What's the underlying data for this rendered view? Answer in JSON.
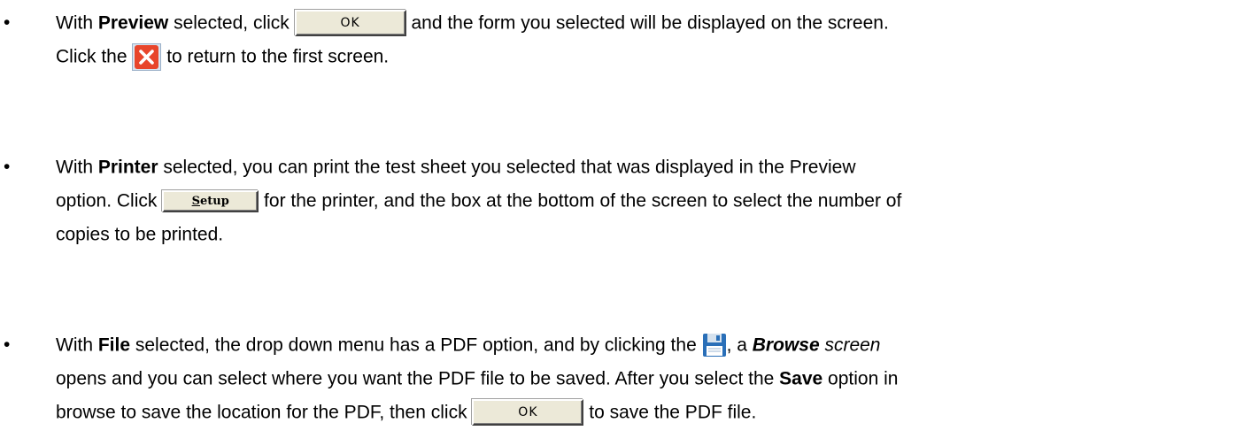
{
  "bullet_glyph": "•",
  "items": [
    {
      "line1": {
        "pre": "With ",
        "bold": "Preview",
        "mid": " selected, click ",
        "button": "OK",
        "post": " and the form you selected will be displayed on the screen."
      },
      "line2": {
        "pre": "Click the ",
        "icon": "close-icon",
        "post": " to return to the first screen."
      }
    },
    {
      "line1": {
        "pre": "With ",
        "bold": "Printer",
        "post": " selected, you can print the test sheet you selected that was displayed in the Preview"
      },
      "line2": {
        "pre": "option. Click ",
        "button_underline": "S",
        "button_rest": "etup",
        "post": " for the printer, and the box at the bottom of the screen to select the number of"
      },
      "line3": {
        "text": "copies to be printed."
      }
    },
    {
      "line1": {
        "pre": "With ",
        "bold": "File",
        "mid": " selected, the drop down menu has a PDF option, and by clicking the ",
        "icon": "save-disk-icon",
        "mid2": ", a ",
        "bold_italic": "Browse",
        "italic": " screen"
      },
      "line2": {
        "pre": "opens and you can select where you want the PDF file to be saved.  After you select the ",
        "bold": "Save",
        "post": " option in"
      },
      "line3": {
        "pre": "browse to save the location for the PDF, then click ",
        "button": "OK",
        "post": " to save the PDF file."
      }
    }
  ],
  "colors": {
    "close_icon_red": "#e8452b",
    "save_icon_blue": "#2a6fb8",
    "button_face": "#ece9d8"
  }
}
